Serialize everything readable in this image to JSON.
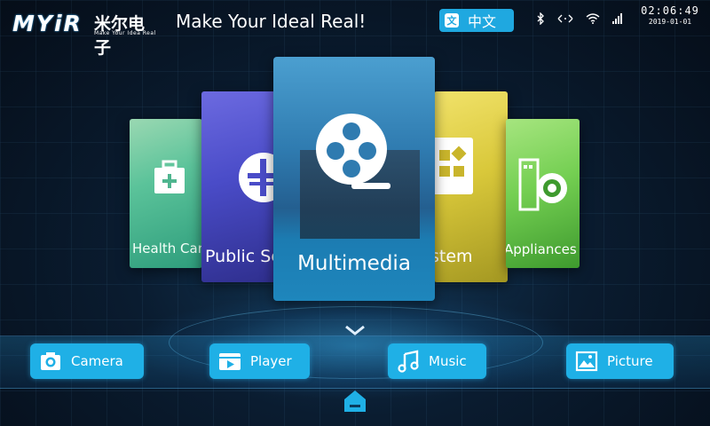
{
  "header": {
    "logo_text": "MYiR",
    "logo_cn": "米尔电子",
    "logo_tagline": "Make Your Idea Real",
    "slogan": "Make Your Ideal Real!",
    "language_button": "中文",
    "language_icon": "文",
    "status_icons": [
      "bluetooth-icon",
      "network-arrows-icon",
      "wifi-icon",
      "signal-icon"
    ],
    "time": "02:06:49",
    "date": "2019-01-01"
  },
  "carousel": {
    "cards": [
      {
        "id": "health",
        "label": "Health Car",
        "icon": "medical-kit-icon",
        "color": "#5bc39a"
      },
      {
        "id": "public",
        "label": "Public Se",
        "icon": "public-service-icon",
        "color": "#4a4cc8"
      },
      {
        "id": "multimedia",
        "label": "Multimedia",
        "icon": "film-reel-icon",
        "color": "#2f7bb0"
      },
      {
        "id": "system",
        "label": "stem",
        "icon": "system-grid-icon",
        "color": "#d9c83a"
      },
      {
        "id": "appliances",
        "label": "Appliances",
        "icon": "washing-machine-icon",
        "color": "#74cf52"
      }
    ],
    "active": "Multimedia"
  },
  "dock": {
    "buttons": [
      {
        "label": "Camera",
        "icon": "camera-icon"
      },
      {
        "label": "Player",
        "icon": "video-player-icon"
      },
      {
        "label": "Music",
        "icon": "music-note-icon"
      },
      {
        "label": "Picture",
        "icon": "picture-icon"
      }
    ]
  },
  "colors": {
    "accent": "#1fb0e6",
    "background": "#0a1c30"
  }
}
